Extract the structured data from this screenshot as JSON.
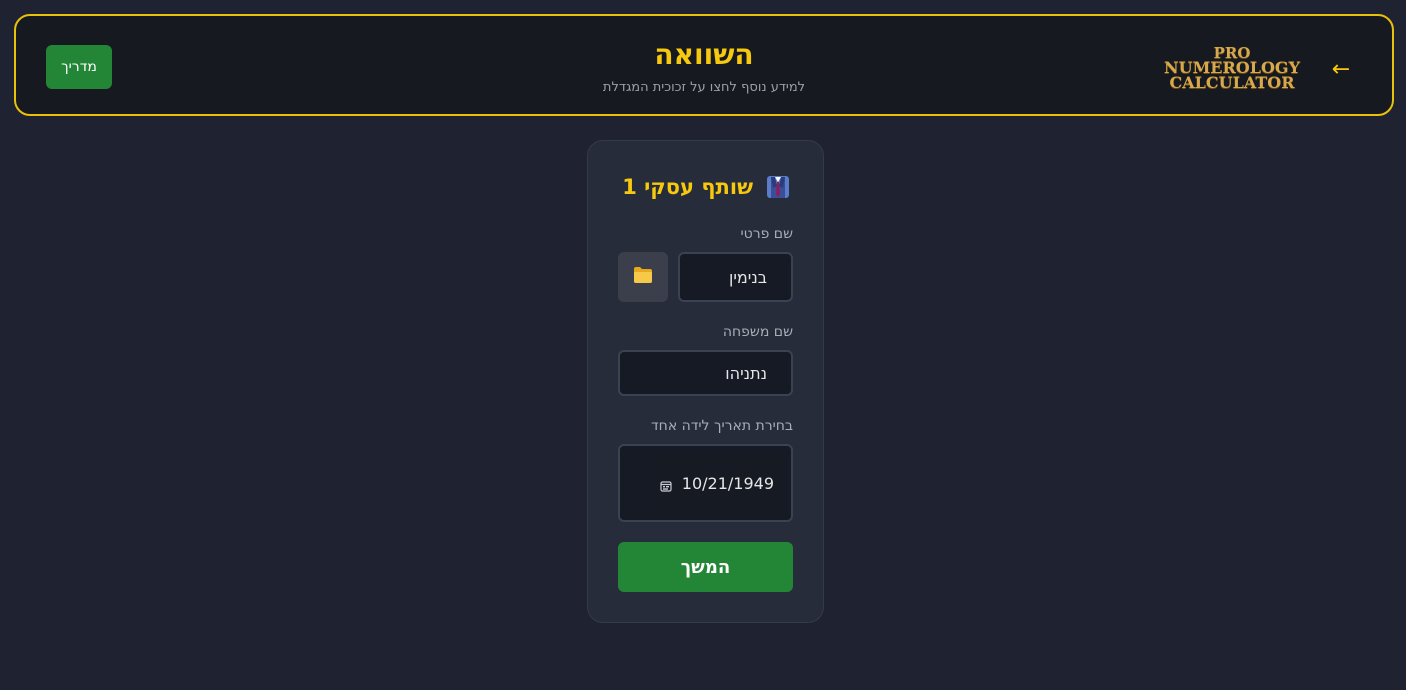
{
  "header": {
    "title": "השוואה",
    "subtitle": "למידע נוסף לחצו על זכוכית המגדלת",
    "guide_button": "מדריך",
    "logo": {
      "line1": "PRO",
      "line2": "NUMEROLOGY",
      "line3": "CALCULATOR"
    },
    "back_icon": "arrow-left-icon",
    "back_glyph": "←"
  },
  "card": {
    "title": "שותף עסקי 1",
    "title_icon": "business-suit-icon",
    "first_name": {
      "label": "שם פרטי",
      "value": "בנימין"
    },
    "folder_icon": "folder-icon",
    "last_name": {
      "label": "שם משפחה",
      "value": "נתניהו"
    },
    "birth_date": {
      "label": "בחירת תאריך לידה אחד",
      "value": "10/21/1949",
      "icon": "calendar-icon"
    },
    "continue_button": "המשך"
  },
  "colors": {
    "background": "#1f2231",
    "header_background": "#161a20",
    "accent_gold": "#f6c90e",
    "button_green": "#238636",
    "card_background": "#272c3a"
  }
}
